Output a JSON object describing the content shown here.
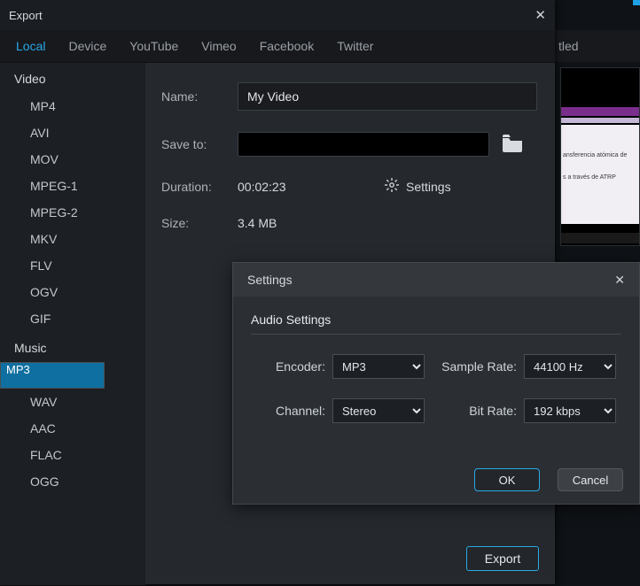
{
  "bg": {
    "title": "tled",
    "paper_line1": "ansferencia atómica de",
    "paper_line2": "s a través de ATRP"
  },
  "dialog": {
    "title": "Export",
    "tabs": [
      "Local",
      "Device",
      "YouTube",
      "Vimeo",
      "Facebook",
      "Twitter"
    ],
    "active_tab": "Local",
    "sidebar": {
      "video_header": "Video",
      "video": [
        "MP4",
        "AVI",
        "MOV",
        "MPEG-1",
        "MPEG-2",
        "MKV",
        "FLV",
        "OGV",
        "GIF"
      ],
      "music_header": "Music",
      "music": [
        "MP3",
        "WAV",
        "AAC",
        "FLAC",
        "OGG"
      ],
      "selected": "MP3"
    },
    "fields": {
      "name_label": "Name:",
      "name_value": "My Video",
      "saveto_label": "Save to:",
      "saveto_value": "",
      "duration_label": "Duration:",
      "duration_value": "00:02:23",
      "settings_label": "Settings",
      "size_label": "Size:",
      "size_value": "3.4 MB"
    },
    "export_btn": "Export"
  },
  "settings": {
    "title": "Settings",
    "section": "Audio Settings",
    "encoder_label": "Encoder:",
    "encoder_value": "MP3",
    "samplerate_label": "Sample Rate:",
    "samplerate_value": "44100 Hz",
    "channel_label": "Channel:",
    "channel_value": "Stereo",
    "bitrate_label": "Bit Rate:",
    "bitrate_value": "192 kbps",
    "ok": "OK",
    "cancel": "Cancel"
  }
}
